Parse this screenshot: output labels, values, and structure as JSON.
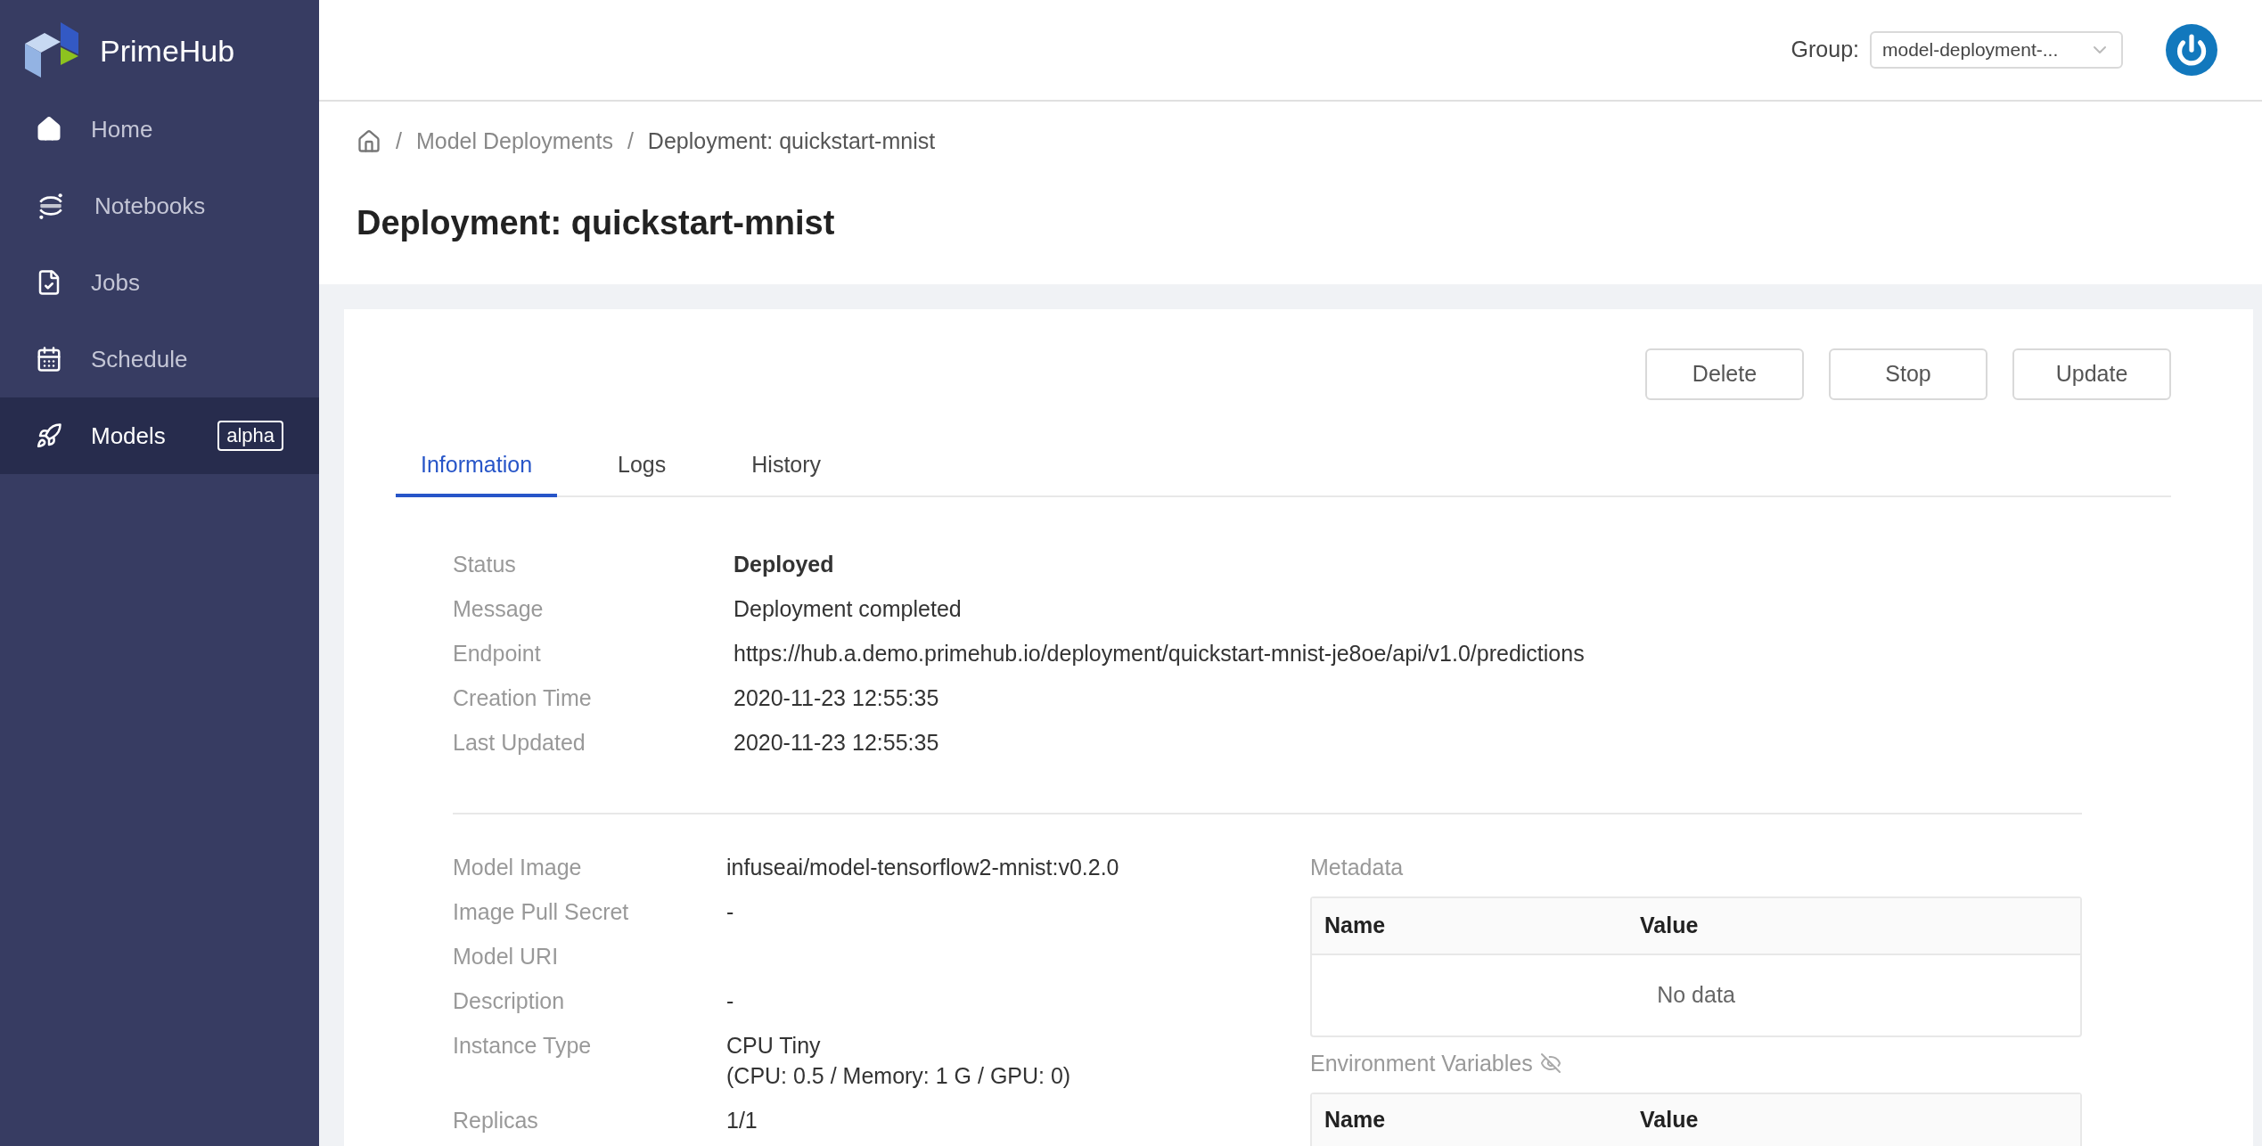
{
  "sidebar": {
    "brand": "PrimeHub",
    "items": [
      {
        "label": "Home",
        "selected": false
      },
      {
        "label": "Notebooks",
        "selected": false
      },
      {
        "label": "Jobs",
        "selected": false
      },
      {
        "label": "Schedule",
        "selected": false
      },
      {
        "label": "Models",
        "selected": true,
        "badge": "alpha"
      }
    ]
  },
  "header": {
    "group_label": "Group:",
    "group_value": "model-deployment-..."
  },
  "breadcrumb": [
    {
      "kind": "separator",
      "text": "/"
    },
    {
      "kind": "link",
      "text": "Model Deployments"
    },
    {
      "kind": "separator",
      "text": "/"
    },
    {
      "kind": "current",
      "text": "Deployment: quickstart-mnist"
    }
  ],
  "title": "Deployment: quickstart-mnist",
  "actions": [
    "Delete",
    "Stop",
    "Update"
  ],
  "tabs": [
    {
      "label": "Information",
      "selected": true
    },
    {
      "label": "Logs",
      "selected": false
    },
    {
      "label": "History",
      "selected": false
    }
  ],
  "info": [
    {
      "label": "Status",
      "value": "Deployed",
      "bold": true
    },
    {
      "label": "Message",
      "value": "Deployment completed",
      "bold": false
    },
    {
      "label": "Endpoint",
      "value": "https://hub.a.demo.primehub.io/deployment/quickstart-mnist-je8oe/api/v1.0/predictions",
      "bold": false
    },
    {
      "label": "Creation Time",
      "value": "2020-11-23 12:55:35",
      "bold": false
    },
    {
      "label": "Last Updated",
      "value": "2020-11-23 12:55:35",
      "bold": false
    }
  ],
  "details": [
    {
      "label": "Model Image",
      "lines": [
        "infuseai/model-tensorflow2-mnist:v0.2.0"
      ]
    },
    {
      "label": "Image Pull Secret",
      "lines": [
        "-"
      ]
    },
    {
      "label": "Model URI"
    },
    {
      "label": "Description",
      "lines": [
        "-"
      ]
    },
    {
      "label": "Instance Type",
      "lines": [
        "CPU Tiny",
        "(CPU: 0.5 / Memory: 1 G / GPU: 0)"
      ]
    },
    {
      "label": "Replicas",
      "lines": [
        "1/1"
      ]
    }
  ],
  "metadata": {
    "title": "Metadata",
    "columns": [
      "Name",
      "Value"
    ],
    "empty": "No data"
  },
  "env": {
    "title": "Environment Variables",
    "columns": [
      "Name",
      "Value"
    ]
  }
}
